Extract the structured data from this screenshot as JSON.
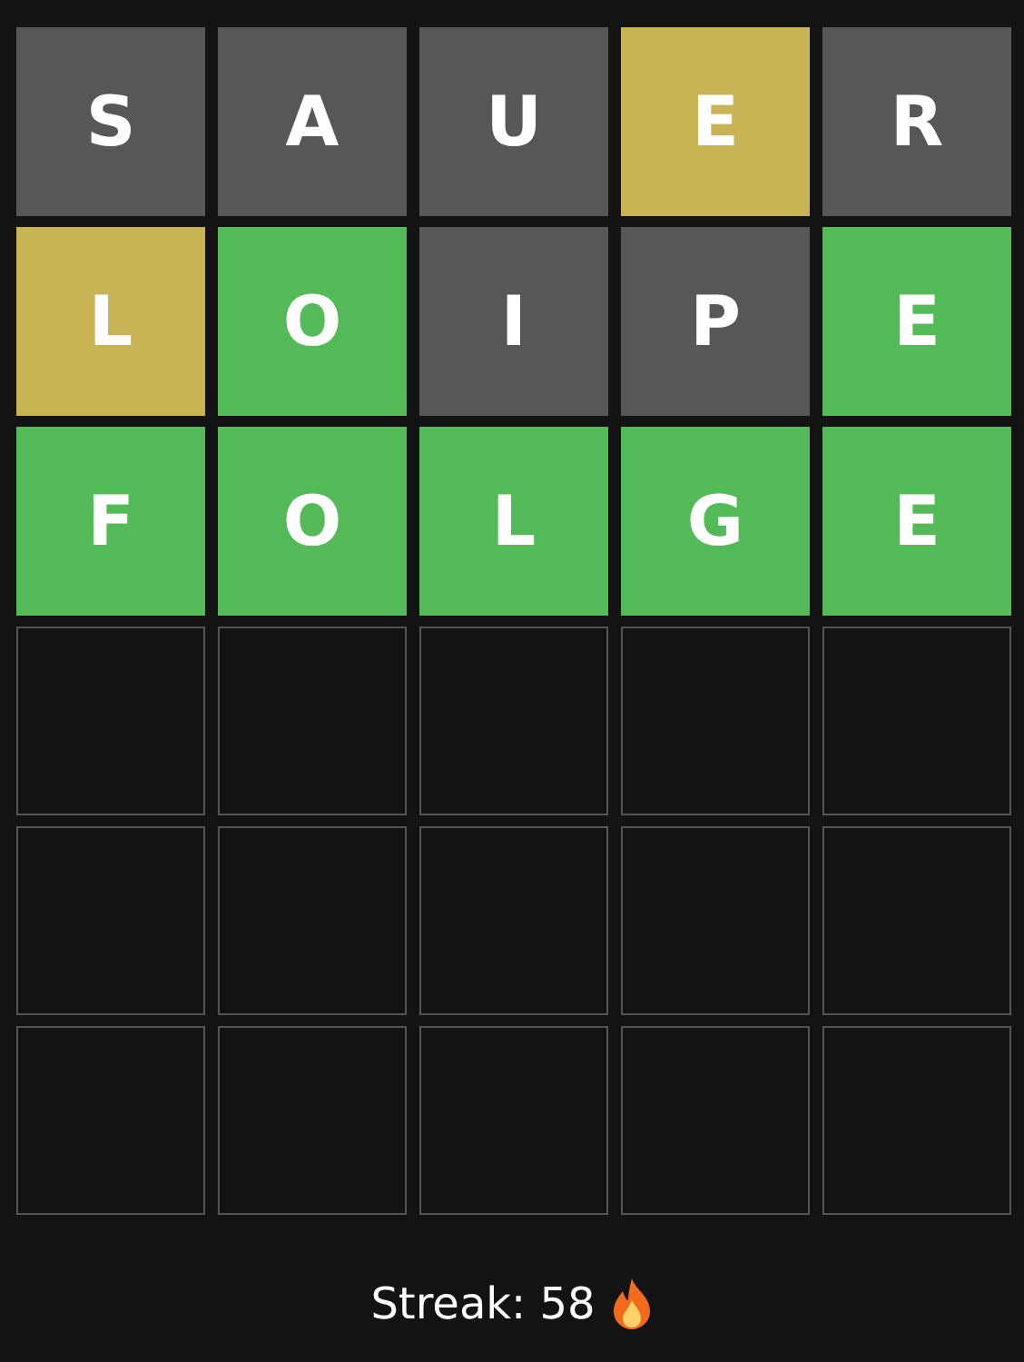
{
  "board": {
    "rows": [
      {
        "tiles": [
          {
            "letter": "S",
            "kind": "absent"
          },
          {
            "letter": "A",
            "kind": "absent"
          },
          {
            "letter": "U",
            "kind": "absent"
          },
          {
            "letter": "E",
            "kind": "present"
          },
          {
            "letter": "R",
            "kind": "absent"
          }
        ]
      },
      {
        "tiles": [
          {
            "letter": "L",
            "kind": "present"
          },
          {
            "letter": "O",
            "kind": "correct"
          },
          {
            "letter": "I",
            "kind": "absent"
          },
          {
            "letter": "P",
            "kind": "absent"
          },
          {
            "letter": "E",
            "kind": "correct"
          }
        ]
      },
      {
        "tiles": [
          {
            "letter": "F",
            "kind": "correct"
          },
          {
            "letter": "O",
            "kind": "correct"
          },
          {
            "letter": "L",
            "kind": "correct"
          },
          {
            "letter": "G",
            "kind": "correct"
          },
          {
            "letter": "E",
            "kind": "correct"
          }
        ]
      },
      {
        "tiles": [
          {
            "kind": "empty"
          },
          {
            "kind": "empty"
          },
          {
            "kind": "empty"
          },
          {
            "kind": "empty"
          },
          {
            "kind": "empty"
          }
        ]
      },
      {
        "tiles": [
          {
            "kind": "empty"
          },
          {
            "kind": "empty"
          },
          {
            "kind": "empty"
          },
          {
            "kind": "empty"
          },
          {
            "kind": "empty"
          }
        ]
      },
      {
        "tiles": [
          {
            "kind": "empty"
          },
          {
            "kind": "empty"
          },
          {
            "kind": "empty"
          },
          {
            "kind": "empty"
          },
          {
            "kind": "empty"
          }
        ]
      }
    ]
  },
  "streak": {
    "label": "Streak: 58"
  }
}
